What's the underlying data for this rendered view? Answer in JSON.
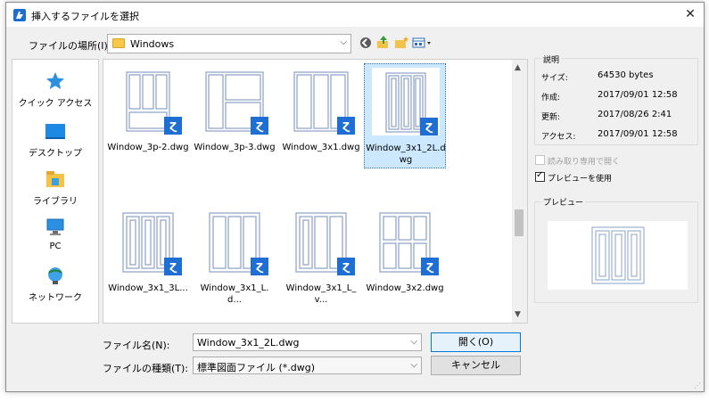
{
  "window": {
    "title": "挿入するファイルを選択",
    "close": "✕"
  },
  "location": {
    "label": "ファイルの場所(I):",
    "value": "Windows"
  },
  "places": [
    {
      "label": "クイック アクセス",
      "icon": "star-icon"
    },
    {
      "label": "デスクトップ",
      "icon": "desktop-icon"
    },
    {
      "label": "ライブラリ",
      "icon": "library-icon"
    },
    {
      "label": "PC",
      "icon": "pc-icon"
    },
    {
      "label": "ネットワーク",
      "icon": "network-icon"
    }
  ],
  "files": [
    {
      "name": "Window_3p-2.dwg",
      "selected": false
    },
    {
      "name": "Window_3p-3.dwg",
      "selected": false
    },
    {
      "name": "Window_3x1.dwg",
      "selected": false
    },
    {
      "name": "Window_3x1_2L.dwg",
      "selected": true
    },
    {
      "name": "Window_3x1_3L...",
      "selected": false
    },
    {
      "name": "Window_3x1_L.d...",
      "selected": false
    },
    {
      "name": "Window_3x1_L_v...",
      "selected": false
    },
    {
      "name": "Window_3x2.dwg",
      "selected": false
    }
  ],
  "filename": {
    "label": "ファイル名(N):",
    "value": "Window_3x1_2L.dwg"
  },
  "filetype": {
    "label": "ファイルの種類(T):",
    "value": "標準図面ファイル (*.dwg)"
  },
  "buttons": {
    "open": "開く(O)",
    "cancel": "キャンセル"
  },
  "info": {
    "title": "説明",
    "rows": [
      {
        "key": "サイズ:",
        "value": "64530 bytes"
      },
      {
        "key": "作成:",
        "value": "2017/09/01 12:58"
      },
      {
        "key": "更新:",
        "value": "2017/08/26 2:41"
      },
      {
        "key": "アクセス:",
        "value": "2017/09/01 12:58"
      }
    ]
  },
  "options": {
    "readonly": {
      "label": "読み取り専用で開く",
      "checked": false,
      "enabled": false
    },
    "use_preview": {
      "label": "プレビューを使用",
      "checked": true,
      "enabled": true
    }
  },
  "preview": {
    "title": "プレビュー"
  },
  "colors": {
    "accent": "#1f6ed4",
    "selection": "#cce8ff",
    "drawing_line": "#8aa0c8"
  }
}
